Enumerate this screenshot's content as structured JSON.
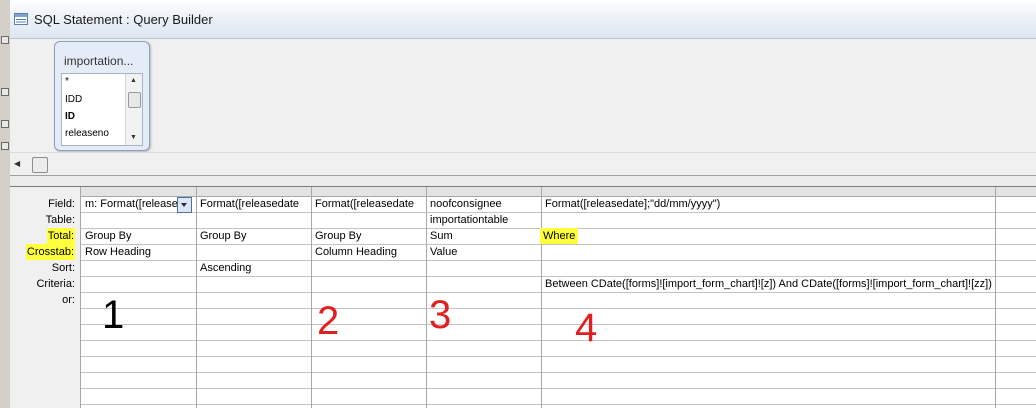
{
  "window": {
    "title": "SQL Statement : Query Builder"
  },
  "table_box": {
    "title": "importation...",
    "fields": [
      {
        "name": "*",
        "key": false
      },
      {
        "name": "IDD",
        "key": false
      },
      {
        "name": "ID",
        "key": true
      },
      {
        "name": "releaseno",
        "key": false
      }
    ]
  },
  "grid": {
    "row_labels": {
      "field": "Field:",
      "table": "Table:",
      "total": "Total:",
      "crosstab": "Crosstab:",
      "sort": "Sort:",
      "criteria": "Criteria:",
      "or": "or:"
    },
    "columns": [
      {
        "field": "m: Format([releasedate];",
        "table": "",
        "total": "Group By",
        "crosstab": "Row Heading",
        "sort": "",
        "criteria": ""
      },
      {
        "field": "Format([releasedate",
        "table": "",
        "total": "Group By",
        "crosstab": "",
        "sort": "Ascending",
        "criteria": ""
      },
      {
        "field": "Format([releasedate",
        "table": "",
        "total": "Group By",
        "crosstab": "Column Heading",
        "sort": "",
        "criteria": ""
      },
      {
        "field": "noofconsignee",
        "table": "importationtable",
        "total": "Sum",
        "crosstab": "Value",
        "sort": "",
        "criteria": ""
      },
      {
        "field": "Format([releasedate];\"dd/mm/yyyy\")",
        "table": "",
        "total": "Where",
        "crosstab": "",
        "sort": "",
        "criteria": "Between CDate([forms]![import_form_chart]![z]) And CDate([forms]![import_form_chart]![zz])"
      }
    ]
  },
  "annotations": [
    {
      "text": "1",
      "color": "#000000"
    },
    {
      "text": "2",
      "color": "#e02020"
    },
    {
      "text": "3",
      "color": "#e02020"
    },
    {
      "text": "4",
      "color": "#e02020"
    }
  ],
  "colors": {
    "highlight": "#ffff3c",
    "grid_line": "#c4c4c4",
    "title_bg": "#eef3f9"
  }
}
